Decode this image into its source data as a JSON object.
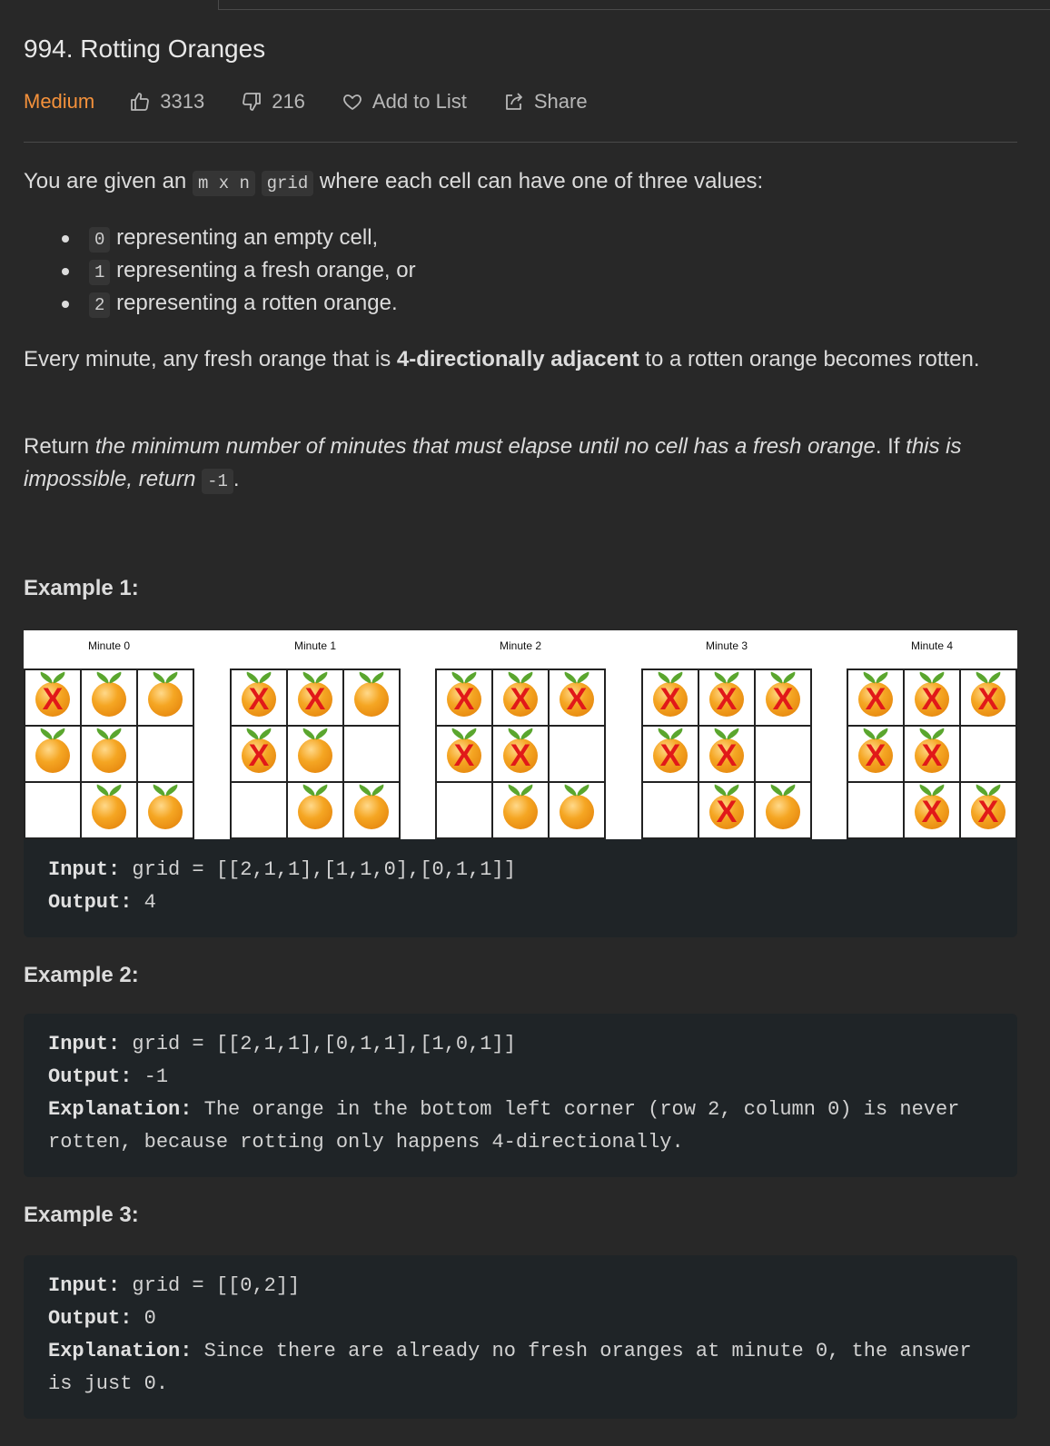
{
  "problem": {
    "title": "994. Rotting Oranges",
    "difficulty": "Medium",
    "likes": "3313",
    "dislikes": "216",
    "add_to_list": "Add to List",
    "share": "Share"
  },
  "description": {
    "intro_pre": "You are given an ",
    "intro_code1": "m x n",
    "intro_code2": "grid",
    "intro_post": " where each cell can have one of three values:",
    "values": [
      {
        "code": "0",
        "text": " representing an empty cell,"
      },
      {
        "code": "1",
        "text": " representing a fresh orange, or"
      },
      {
        "code": "2",
        "text": " representing a rotten orange."
      }
    ],
    "rule_pre": "Every minute, any fresh orange that is ",
    "rule_bold": "4-directionally adjacent",
    "rule_post": " to a rotten orange becomes rotten.",
    "return_pre": "Return ",
    "return_italic": "the minimum number of minutes that must elapse until no cell has a fresh orange",
    "return_mid": ". If ",
    "return_italic2": "this is impossible, return",
    "return_code": "-1",
    "return_end": "."
  },
  "figure": {
    "minutes": [
      {
        "label": "Minute 0",
        "grid": [
          [
            2,
            1,
            1
          ],
          [
            1,
            1,
            0
          ],
          [
            0,
            1,
            1
          ]
        ]
      },
      {
        "label": "Minute 1",
        "grid": [
          [
            2,
            2,
            1
          ],
          [
            2,
            1,
            0
          ],
          [
            0,
            1,
            1
          ]
        ]
      },
      {
        "label": "Minute 2",
        "grid": [
          [
            2,
            2,
            2
          ],
          [
            2,
            2,
            0
          ],
          [
            0,
            1,
            1
          ]
        ]
      },
      {
        "label": "Minute 3",
        "grid": [
          [
            2,
            2,
            2
          ],
          [
            2,
            2,
            0
          ],
          [
            0,
            2,
            1
          ]
        ]
      },
      {
        "label": "Minute 4",
        "grid": [
          [
            2,
            2,
            2
          ],
          [
            2,
            2,
            0
          ],
          [
            0,
            2,
            2
          ]
        ]
      }
    ],
    "rotten_mark": "X"
  },
  "examples": [
    {
      "heading": "Example 1:",
      "input_label": "Input:",
      "input": " grid = [[2,1,1],[1,1,0],[0,1,1]]",
      "output_label": "Output:",
      "output": " 4"
    },
    {
      "heading": "Example 2:",
      "input_label": "Input:",
      "input": " grid = [[2,1,1],[0,1,1],[1,0,1]]",
      "output_label": "Output:",
      "output": " -1",
      "explanation_label": "Explanation:",
      "explanation": " The orange in the bottom left corner (row 2, column 0) is never rotten, because rotting only happens 4-directionally."
    },
    {
      "heading": "Example 3:",
      "input_label": "Input:",
      "input": " grid = [[0,2]]",
      "output_label": "Output:",
      "output": " 0",
      "explanation_label": "Explanation:",
      "explanation": " Since there are already no fresh oranges at minute 0, the answer is just 0."
    }
  ],
  "colors": {
    "background": "#282828",
    "difficulty_medium": "#f4913b",
    "code_block_bg": "#1f2427"
  }
}
